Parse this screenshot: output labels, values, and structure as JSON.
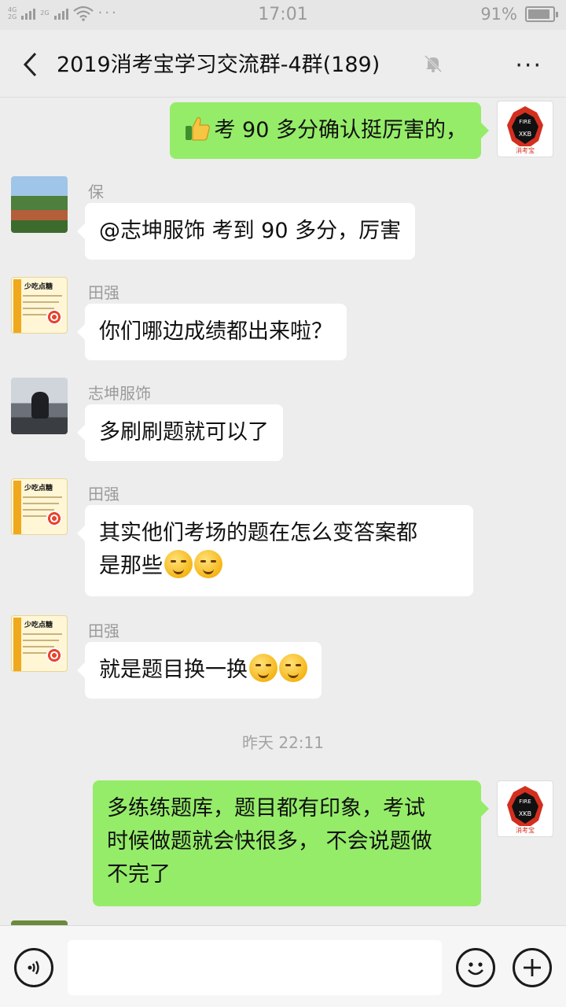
{
  "status_bar": {
    "network_tag_top": "4G",
    "network_tag_bottom": "2G",
    "network_tag_2": "2G",
    "more_dots": "···",
    "time": "17:01",
    "battery_percent": "91%",
    "battery_level": 0.91
  },
  "header": {
    "title": "2019消考宝学习交流群-4群(189)",
    "back_icon": "chevron-left-icon",
    "mute_icon": "bell-mute-icon",
    "more_label": "···"
  },
  "messages": [
    {
      "side": "right",
      "sender": "",
      "avatar": "fire-logo",
      "text": "考 90 多分确认挺厉害的，",
      "prefix_icon": "thumbs-up-icon",
      "emojis": []
    },
    {
      "side": "left",
      "sender": "保",
      "avatar": "landscape",
      "text": "@志坤服饰  考到 90 多分，厉害",
      "emojis": []
    },
    {
      "side": "left",
      "sender": "田强",
      "avatar": "candy-card",
      "text": "你们哪边成绩都出来啦？",
      "emojis": []
    },
    {
      "side": "left",
      "sender": "志坤服饰",
      "avatar": "person-photo",
      "text": "多刷刷题就可以了",
      "emojis": []
    },
    {
      "side": "left",
      "sender": "田强",
      "avatar": "candy-card",
      "text_line1": "其实他们考场的题在怎么变答案都",
      "text_line2": "是那些",
      "emojis": [
        "thinking",
        "smirk"
      ]
    },
    {
      "side": "left",
      "sender": "田强",
      "avatar": "candy-card",
      "text": "就是题目换一换",
      "emojis": [
        "smirk",
        "thinking"
      ]
    },
    {
      "side": "right",
      "sender": "",
      "avatar": "fire-logo",
      "text_line1": "多练练题库，题目都有印象，考试",
      "text_line2": "时候做题就会快很多， 不会说题做",
      "text_line3": "不完了",
      "emojis": []
    }
  ],
  "timestamp": "昨天 22:11",
  "avatar_text": {
    "fire_top": "FIRE",
    "fire_mid": "XKB",
    "fire_brand": "消考宝",
    "candy_title": "少吃点糖"
  },
  "input_bar": {
    "voice_icon": "voice-icon",
    "emoji_icon": "emoji-icon",
    "plus_icon": "plus-icon",
    "value": ""
  },
  "colors": {
    "my_bubble": "#95ec69",
    "other_bubble": "#ffffff",
    "background": "#ededed"
  }
}
